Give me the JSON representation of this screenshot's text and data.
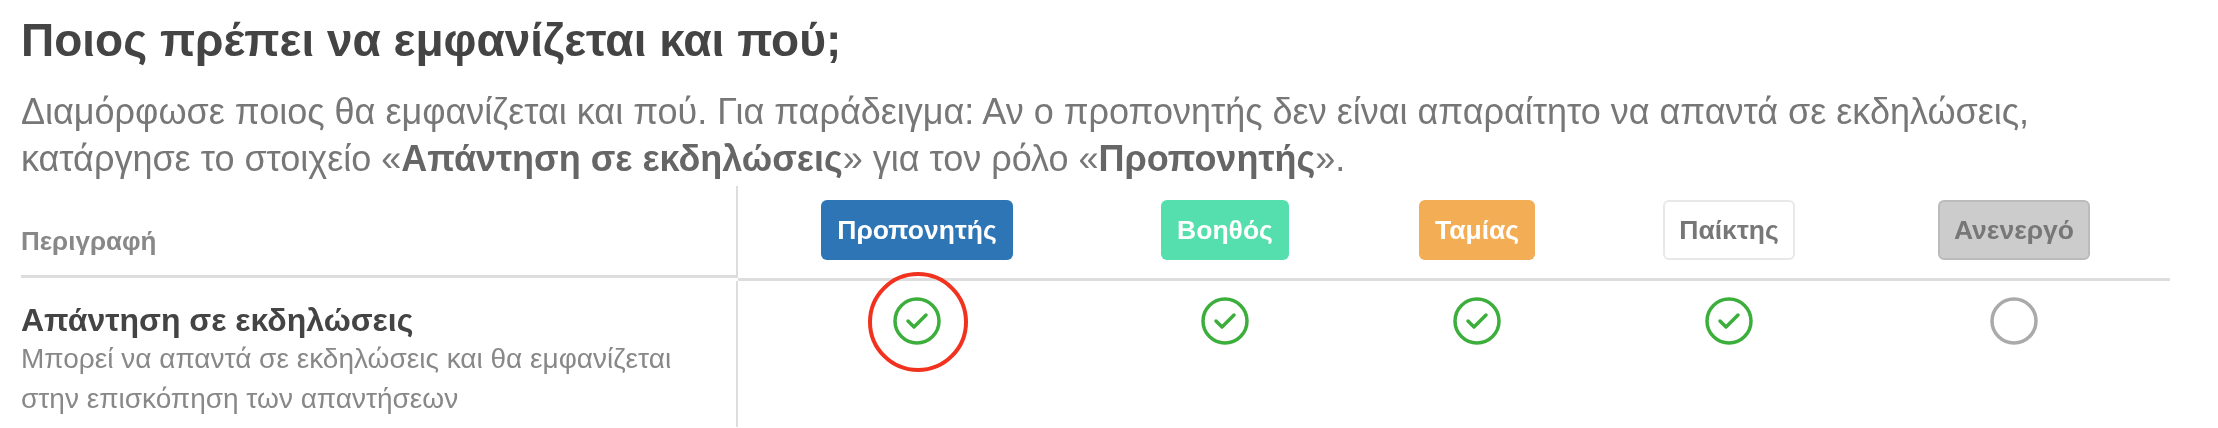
{
  "title": "Ποιος πρέπει να εμφανίζεται και πού;",
  "description": "Διαμόρφωσε ποιος θα εμφανίζεται και πού. Για παράδειγμα: Αν ο προπονητής δεν είναι απαραίτητο να απαντά σε εκδηλώσεις, κατάργησε το στοιχείο «**Απάντηση σε εκδηλώσεις**» για τον ρόλο «**Προπονητής**».",
  "table": {
    "description_heading": "Περιγραφή",
    "roles": [
      {
        "label": "Προπονητής",
        "kind": "filled",
        "color": "#2e75b6"
      },
      {
        "label": "Βοηθός",
        "kind": "filled",
        "color": "#55dfae"
      },
      {
        "label": "Ταμίας",
        "kind": "filled",
        "color": "#f2ad55"
      },
      {
        "label": "Παίκτης",
        "kind": "outline",
        "color": "#ffffff"
      },
      {
        "label": "Ανενεργό",
        "kind": "disabled",
        "color": "#cccccc"
      }
    ],
    "rows": [
      {
        "title": "Απάντηση σε εκδηλώσεις",
        "subtitle": "Μπορεί να απαντά σε εκδηλώσεις και θα εμφανίζεται στην επισκόπηση των απαντήσεων",
        "cells": [
          {
            "checked": true,
            "highlighted": true
          },
          {
            "checked": true,
            "highlighted": false
          },
          {
            "checked": true,
            "highlighted": false
          },
          {
            "checked": true,
            "highlighted": false
          },
          {
            "checked": false,
            "highlighted": false
          }
        ]
      }
    ]
  }
}
